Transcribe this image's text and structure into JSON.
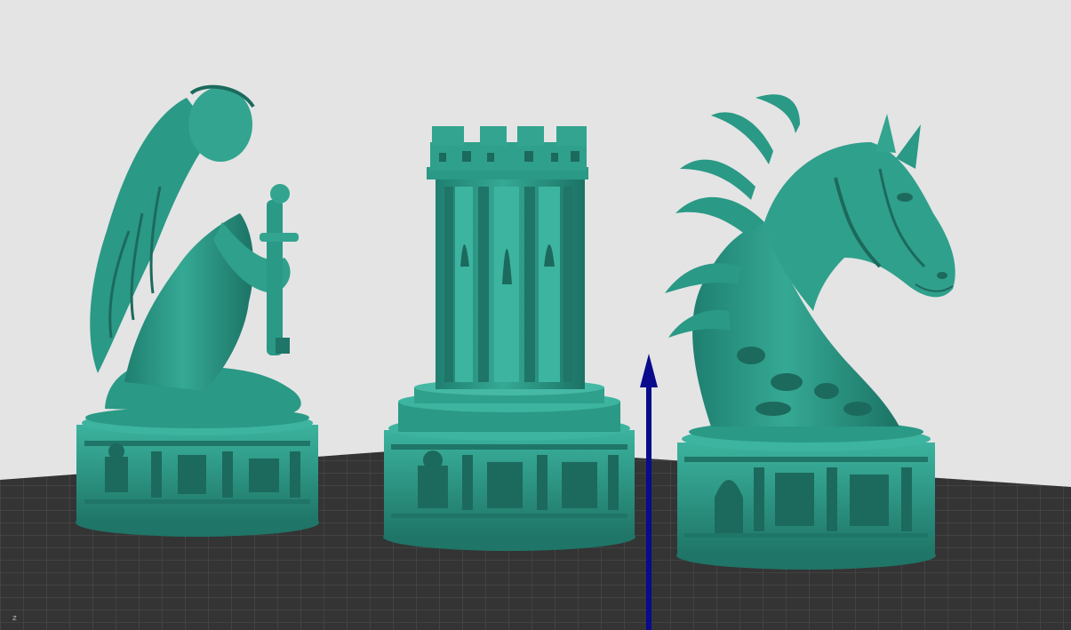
{
  "scene": {
    "background_color": "#e4e4e4",
    "bed_color": "#3c3c3c",
    "grid_color": "#5a5a5a",
    "model_color": "#2e9c8a",
    "model_shadow_color": "#1f6f62",
    "model_highlight_color": "#4dbfac",
    "axis_color": "#0a0a8c"
  },
  "objects": [
    {
      "name": "kneeling-warrior-model",
      "piece": "pawn",
      "state": "unselected"
    },
    {
      "name": "rook-tower-model",
      "piece": "rook",
      "state": "unselected"
    },
    {
      "name": "horse-knight-model",
      "piece": "knight",
      "state": "unselected"
    }
  ],
  "gizmo": {
    "type": "move-arrow",
    "axis": "z"
  },
  "axis_indicator_label": "z"
}
